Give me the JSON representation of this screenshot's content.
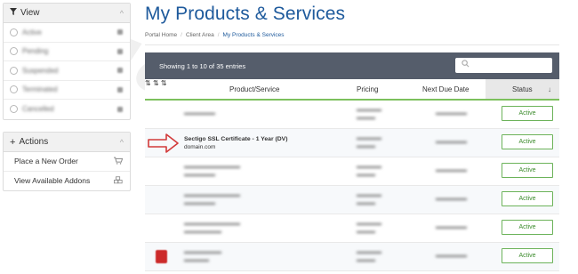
{
  "sidebar": {
    "view": {
      "title": "View",
      "items": [
        {
          "label": "Active"
        },
        {
          "label": "Pending"
        },
        {
          "label": "Suspended"
        },
        {
          "label": "Terminated"
        },
        {
          "label": "Cancelled"
        }
      ]
    },
    "actions": {
      "title": "Actions",
      "items": [
        {
          "label": "Place a New Order",
          "icon": "cart-icon"
        },
        {
          "label": "View Available Addons",
          "icon": "cubes-icon"
        }
      ]
    }
  },
  "page": {
    "title": "My Products & Services",
    "breadcrumb": {
      "home": "Portal Home",
      "area": "Client Area",
      "current": "My Products & Services"
    }
  },
  "table": {
    "info": "Showing 1 to 10 of 35 entries",
    "columns": [
      "Product/Service",
      "Pricing",
      "Next Due Date",
      "Status"
    ],
    "rows": [
      {
        "name": "",
        "domain": "",
        "status": "Active"
      },
      {
        "name": "Sectigo SSL Certificate - 1 Year (DV)",
        "domain": "domain.com",
        "status": "Active"
      },
      {
        "name": "",
        "domain": "",
        "status": "Active"
      },
      {
        "name": "",
        "domain": "",
        "status": "Active"
      },
      {
        "name": "",
        "domain": "",
        "status": "Active"
      },
      {
        "name": "",
        "domain": "",
        "status": "Active"
      }
    ]
  },
  "colors": {
    "accent": "#1e5a9c",
    "status_green": "#3c8b2c",
    "toolbar": "#555d6b",
    "arrow_red": "#d23a3a"
  },
  "watermark": "MonoVM"
}
